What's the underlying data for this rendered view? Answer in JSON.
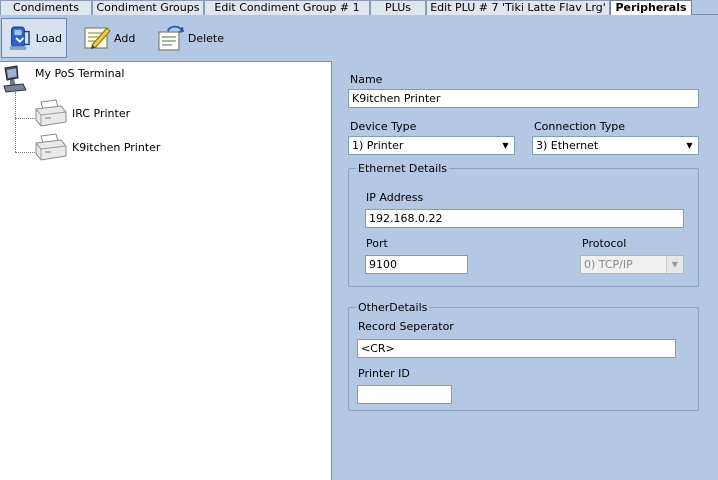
{
  "tabs": [
    {
      "label": "Condiments"
    },
    {
      "label": "Condiment Groups"
    },
    {
      "label": "Edit Condiment Group # 1"
    },
    {
      "label": "PLUs"
    },
    {
      "label": "Edit PLU # 7 'Tiki Latte Flav Lrg'"
    },
    {
      "label": "Peripherals",
      "active": true
    }
  ],
  "toolbar": {
    "load_label": "Load",
    "add_label": "Add",
    "delete_label": "Delete"
  },
  "tree": {
    "root": "My PoS Terminal",
    "children": [
      "IRC Printer",
      "K9itchen Printer"
    ]
  },
  "form": {
    "name_label": "Name",
    "name_value": "K9itchen Printer",
    "device_type_label": "Device Type",
    "device_type_value": "1) Printer",
    "connection_type_label": "Connection Type",
    "connection_type_value": "3) Ethernet",
    "ethernet_group_title": "Ethernet Details",
    "ip_label": "IP Address",
    "ip_value": "192.168.0.22",
    "port_label": "Port",
    "port_value": "9100",
    "protocol_label": "Protocol",
    "protocol_value": "0) TCP/IP",
    "other_group_title": "OtherDetails",
    "record_sep_label": "Record Seperator",
    "record_sep_value": "<CR>",
    "printer_id_label": "Printer ID",
    "printer_id_value": ""
  }
}
